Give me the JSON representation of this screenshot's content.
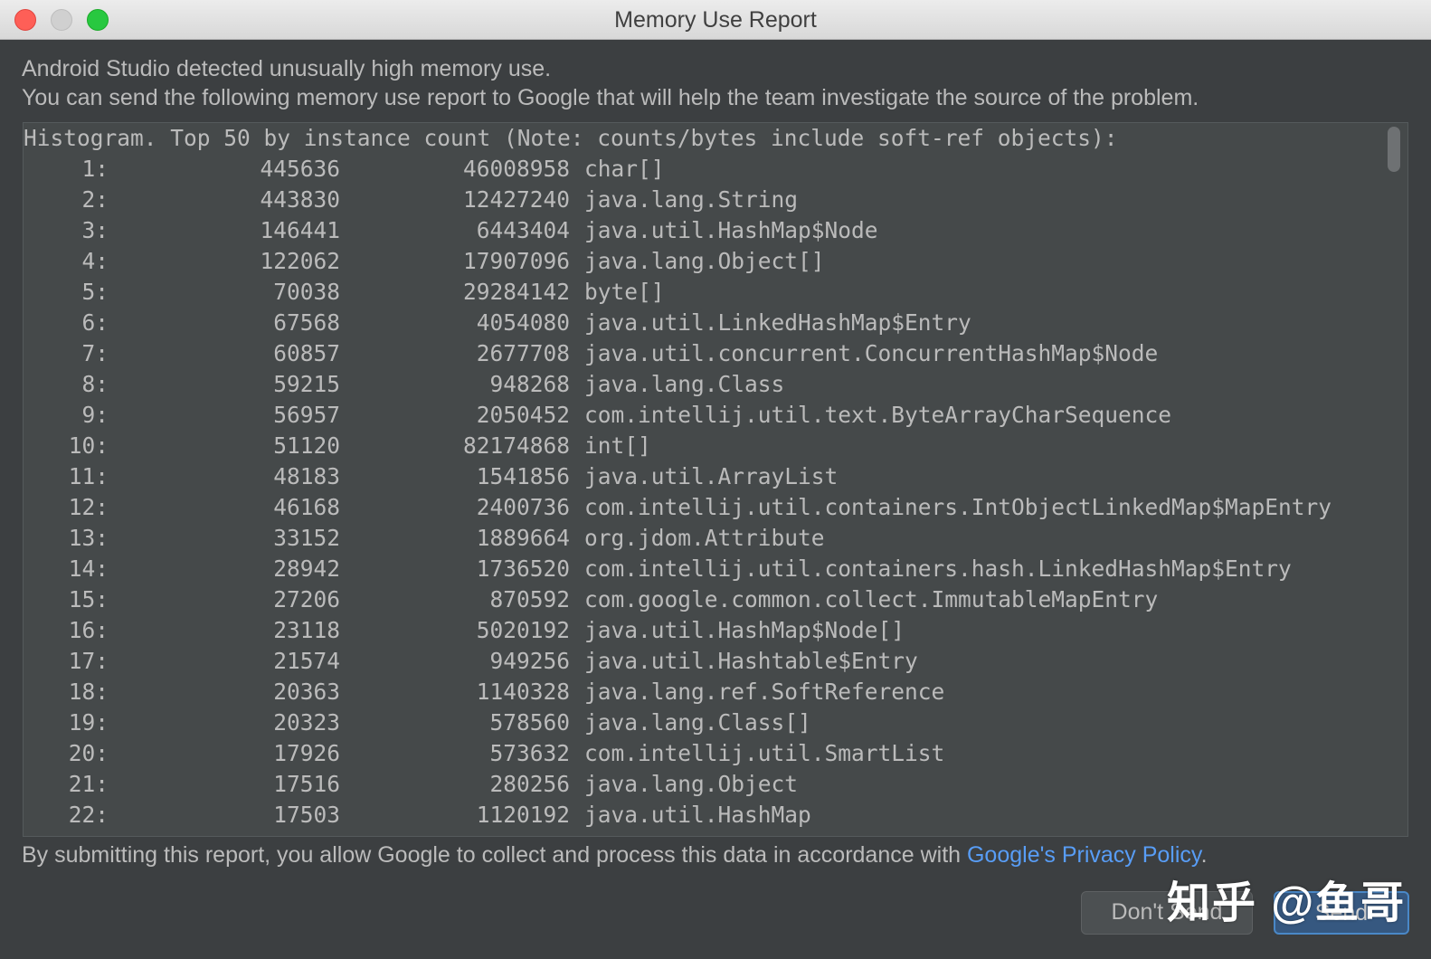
{
  "window": {
    "title": "Memory Use Report"
  },
  "intro": {
    "line1": "Android Studio detected unusually high memory use.",
    "line2": "You can send the following memory use report to Google that will help the team investigate the source of the problem."
  },
  "report": {
    "header": "Histogram. Top 50 by instance count (Note: counts/bytes include soft-ref objects):",
    "rows": [
      {
        "index": "1:",
        "count": "445636",
        "bytes": "46008958",
        "class": "char[]"
      },
      {
        "index": "2:",
        "count": "443830",
        "bytes": "12427240",
        "class": "java.lang.String"
      },
      {
        "index": "3:",
        "count": "146441",
        "bytes": "6443404",
        "class": "java.util.HashMap$Node"
      },
      {
        "index": "4:",
        "count": "122062",
        "bytes": "17907096",
        "class": "java.lang.Object[]"
      },
      {
        "index": "5:",
        "count": "70038",
        "bytes": "29284142",
        "class": "byte[]"
      },
      {
        "index": "6:",
        "count": "67568",
        "bytes": "4054080",
        "class": "java.util.LinkedHashMap$Entry"
      },
      {
        "index": "7:",
        "count": "60857",
        "bytes": "2677708",
        "class": "java.util.concurrent.ConcurrentHashMap$Node"
      },
      {
        "index": "8:",
        "count": "59215",
        "bytes": "948268",
        "class": "java.lang.Class"
      },
      {
        "index": "9:",
        "count": "56957",
        "bytes": "2050452",
        "class": "com.intellij.util.text.ByteArrayCharSequence"
      },
      {
        "index": "10:",
        "count": "51120",
        "bytes": "82174868",
        "class": "int[]"
      },
      {
        "index": "11:",
        "count": "48183",
        "bytes": "1541856",
        "class": "java.util.ArrayList"
      },
      {
        "index": "12:",
        "count": "46168",
        "bytes": "2400736",
        "class": "com.intellij.util.containers.IntObjectLinkedMap$MapEntry"
      },
      {
        "index": "13:",
        "count": "33152",
        "bytes": "1889664",
        "class": "org.jdom.Attribute"
      },
      {
        "index": "14:",
        "count": "28942",
        "bytes": "1736520",
        "class": "com.intellij.util.containers.hash.LinkedHashMap$Entry"
      },
      {
        "index": "15:",
        "count": "27206",
        "bytes": "870592",
        "class": "com.google.common.collect.ImmutableMapEntry"
      },
      {
        "index": "16:",
        "count": "23118",
        "bytes": "5020192",
        "class": "java.util.HashMap$Node[]"
      },
      {
        "index": "17:",
        "count": "21574",
        "bytes": "949256",
        "class": "java.util.Hashtable$Entry"
      },
      {
        "index": "18:",
        "count": "20363",
        "bytes": "1140328",
        "class": "java.lang.ref.SoftReference"
      },
      {
        "index": "19:",
        "count": "20323",
        "bytes": "578560",
        "class": "java.lang.Class[]"
      },
      {
        "index": "20:",
        "count": "17926",
        "bytes": "573632",
        "class": "com.intellij.util.SmartList"
      },
      {
        "index": "21:",
        "count": "17516",
        "bytes": "280256",
        "class": "java.lang.Object"
      },
      {
        "index": "22:",
        "count": "17503",
        "bytes": "1120192",
        "class": "java.util.HashMap"
      }
    ]
  },
  "footer": {
    "text": "By submitting this report, you allow Google to collect and process this data in accordance with ",
    "link": "Google's Privacy Policy",
    "period": "."
  },
  "buttons": {
    "dont_send": "Don't Send",
    "send": "Send"
  },
  "watermark": "知乎 @鱼哥",
  "colors": {
    "background": "#3c3f41",
    "link": "#589df6",
    "primary_button": "#365880"
  }
}
